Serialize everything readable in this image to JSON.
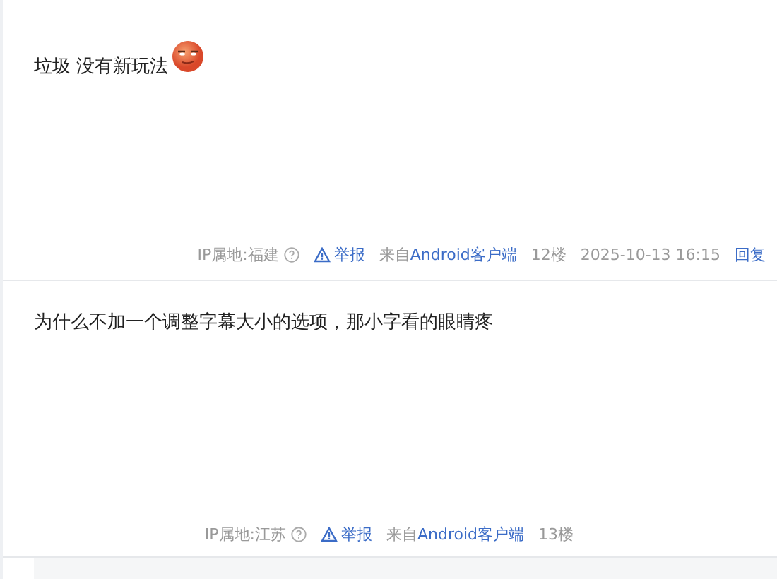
{
  "posts": [
    {
      "text": "垃圾 没有新玩法",
      "emoji": true,
      "footer": {
        "ip": "IP属地:福建",
        "report": "举报",
        "source_prefix": "来自",
        "source": "Android客户端",
        "floor": "12楼",
        "time": "2025-10-13 16:15",
        "reply": "回复"
      }
    },
    {
      "text": "为什么不加一个调整字幕大小的选项，那小字看的眼睛疼",
      "emoji": false,
      "footer": {
        "ip": "IP属地:江苏",
        "report": "举报",
        "source_prefix": "来自",
        "source": "Android客户端",
        "floor": "13楼"
      }
    }
  ]
}
